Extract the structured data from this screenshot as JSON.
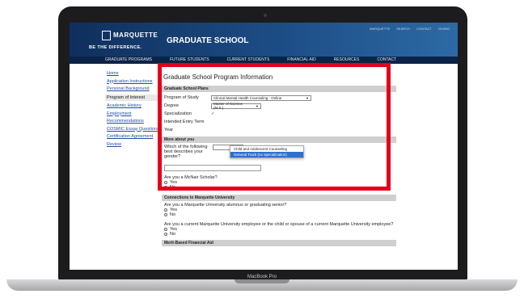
{
  "device": {
    "brand_label": "MacBook Pro"
  },
  "site": {
    "logo_text": "MARQUETTE",
    "tagline": "BE THE DIFFERENCE.",
    "name": "GRADUATE SCHOOL",
    "top_links": [
      "MARQUETTE",
      "SEARCH",
      "CONTACT",
      "GIVING"
    ]
  },
  "nav": [
    "GRADUATE PROGRAMS",
    "FUTURE STUDENTS",
    "CURRENT STUDENTS",
    "FINANCIAL AID",
    "RESOURCES",
    "CONTACT"
  ],
  "sidebar": [
    {
      "label": "Home"
    },
    {
      "label": "Application Instructions"
    },
    {
      "label": "Personal Background"
    },
    {
      "label": "Program of Interest",
      "active": true
    },
    {
      "label": "Academic History"
    },
    {
      "label": "Employment"
    },
    {
      "label": "Recommendations"
    },
    {
      "label": "COSMIC Essay Questions"
    },
    {
      "label": "Certification Agreement"
    },
    {
      "label": "Review"
    }
  ],
  "form": {
    "title": "Graduate School Program Information",
    "plans_header": "Graduate School Plans",
    "program_label": "Program of Study",
    "program_value": "Clinical Mental Health Counseling - Online",
    "degree_label": "Degree",
    "degree_value": "Master of Science (M.S.)",
    "specialization_label": "Specialization",
    "specialization_options": [
      "Child and Adolescent Counseling",
      "General Track (no specialization)"
    ],
    "entry_term_label": "Intended Entry Term",
    "year_label": "Year",
    "about_header": "More about you",
    "gender_label": "Which of the following best describes your gender?",
    "mcnair_label": "Are you a McNair Scholar?",
    "yes": "Yes",
    "no": "No",
    "connections_header": "Connections to Marquette University",
    "alumnus_label": "Are you a Marquette University alumnus or graduating senior?",
    "employee_label": "Are you a current Marquette University employee or the child or spouse of a current Marquette University employee?",
    "merit_header": "Merit-Based Financial Aid"
  },
  "colors": {
    "highlight": "#e3001b",
    "header": "#1d4d86",
    "navbar": "#0b2347"
  }
}
